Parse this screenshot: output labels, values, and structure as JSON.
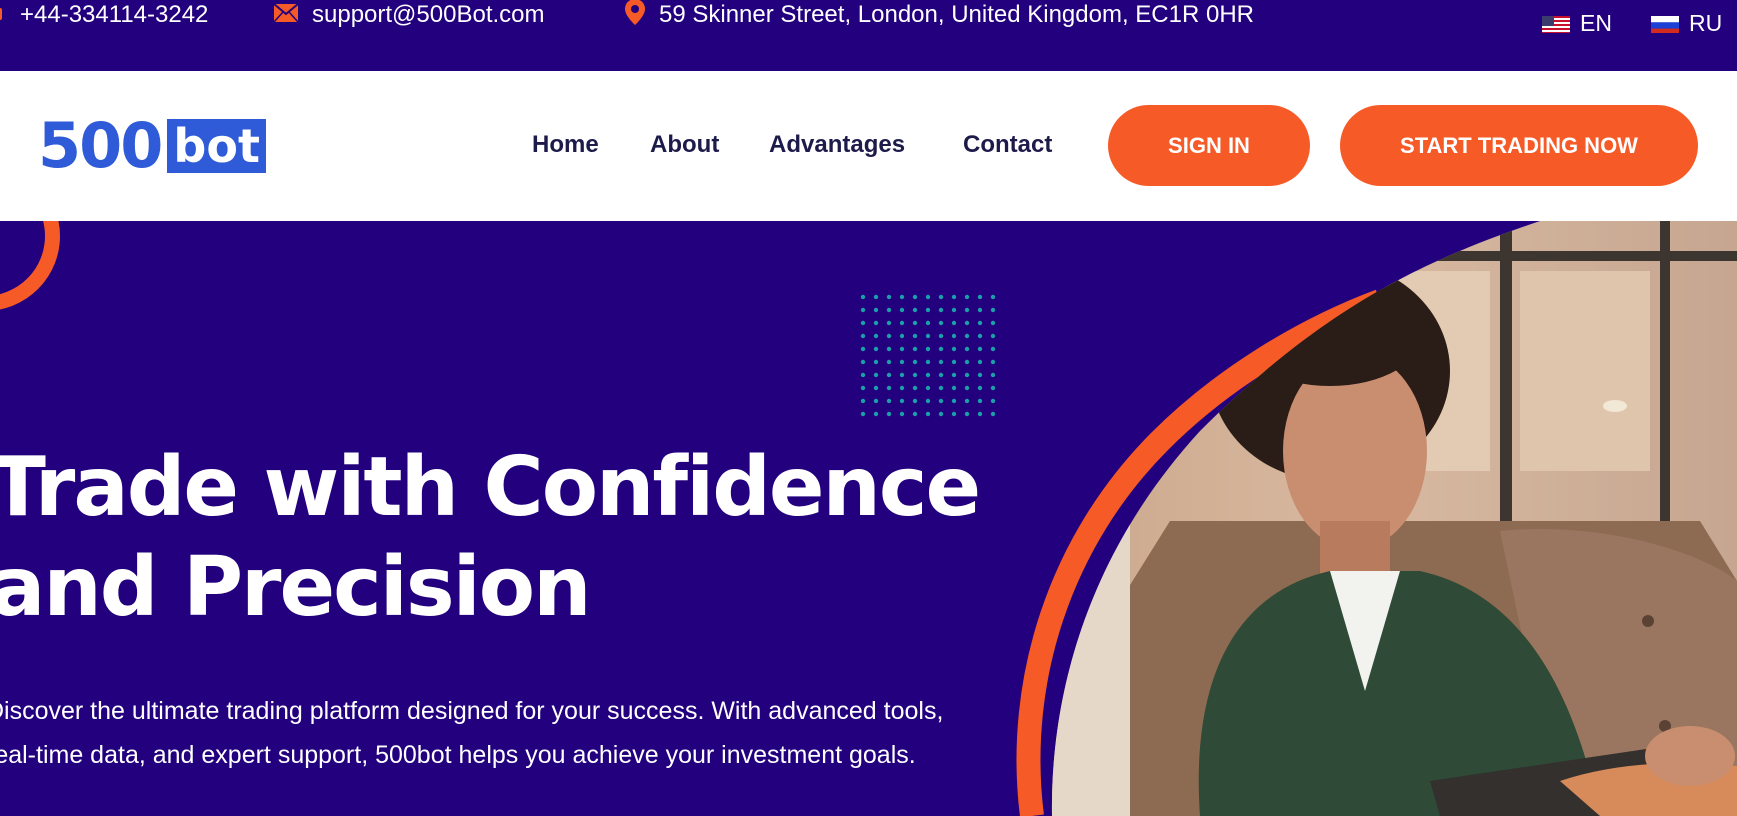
{
  "topbar": {
    "phone": "+44-334114-3242",
    "email": "support@500Bot.com",
    "address": "59 Skinner Street, London, United Kingdom, EC1R 0HR",
    "phone_icon": "phone-icon",
    "email_icon": "envelope-icon",
    "address_icon": "map-pin-icon",
    "languages": [
      {
        "code": "EN",
        "flag": "us-flag-icon"
      },
      {
        "code": "RU",
        "flag": "ru-flag-icon"
      }
    ]
  },
  "header": {
    "logo": {
      "number": "500",
      "word": "bot"
    },
    "nav": [
      {
        "label": "Home"
      },
      {
        "label": "About"
      },
      {
        "label": "Advantages"
      },
      {
        "label": "Contact"
      }
    ],
    "sign_in": "SIGN IN",
    "start_trading": "START TRADING NOW"
  },
  "hero": {
    "title_line1": "Trade with Confidence",
    "title_line2": "and Precision",
    "description": "Discover the ultimate trading platform designed for your success. With advanced tools, real-time data, and expert support, 500bot helps you achieve your investment goals.",
    "image_alt": "Woman in green blazer holding a tablet, seated in a brown leather booth"
  },
  "colors": {
    "primary_bg": "#22007e",
    "accent": "#f65a27",
    "logo_blue": "#2f5bd8",
    "nav_text": "#1d1b4a",
    "dots": "#1aa0a8"
  }
}
